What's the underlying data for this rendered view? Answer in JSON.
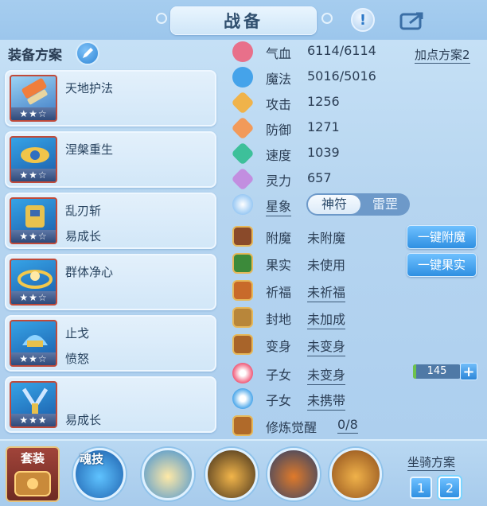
{
  "header": {
    "title": "战备"
  },
  "scheme": {
    "label": "装备方案"
  },
  "cards": [
    {
      "name": "天地护法",
      "sub": "",
      "stars": "★★☆"
    },
    {
      "name": "涅槃重生",
      "sub": "",
      "stars": "★★☆"
    },
    {
      "name": "乱刃斩",
      "sub": "易成长",
      "stars": "★★☆"
    },
    {
      "name": "群体净心",
      "sub": "",
      "stars": "★★☆"
    },
    {
      "name": "止戈",
      "sub": "愤怒",
      "stars": "★★☆"
    },
    {
      "name": "",
      "sub": "易成长",
      "stars": "★★★"
    }
  ],
  "stats": {
    "plus_scheme": "加点方案2",
    "hp": {
      "label": "气血",
      "value": "6114/6114"
    },
    "mp": {
      "label": "魔法",
      "value": "5016/5016"
    },
    "atk": {
      "label": "攻击",
      "value": "1256"
    },
    "def": {
      "label": "防御",
      "value": "1271"
    },
    "spd": {
      "label": "速度",
      "value": "1039"
    },
    "spi": {
      "label": "灵力",
      "value": "657"
    },
    "star": {
      "label": "星象",
      "opt_on": "神符",
      "opt_off": "雷罡"
    }
  },
  "attrs": {
    "enchant": {
      "label": "附魔",
      "value": "未附魔",
      "button": "一键附魔"
    },
    "fruit": {
      "label": "果实",
      "value": "未使用",
      "button": "一键果实"
    },
    "bless": {
      "label": "祈福",
      "value": "未祈福"
    },
    "seal": {
      "label": "封地",
      "value": "未加成"
    },
    "transform": {
      "label": "变身",
      "value": "未变身"
    },
    "child1": {
      "label": "子女",
      "value": "未变身"
    },
    "child2": {
      "label": "子女",
      "value": "未携带"
    },
    "cultivate": {
      "label": "修炼觉醒",
      "value": "0/8"
    }
  },
  "counter": {
    "value": "145",
    "fill_fraction": 0.06,
    "plus": "+"
  },
  "bottom": {
    "suit_label": "套装",
    "soul_label": "魂技",
    "mount_label": "坐骑方案",
    "mount_options": [
      "1",
      "2"
    ]
  },
  "colors": {
    "accent_blue": "#2f90e2",
    "card_border_red": "#c04a3a",
    "bg_blue": "#b6d5f0"
  }
}
